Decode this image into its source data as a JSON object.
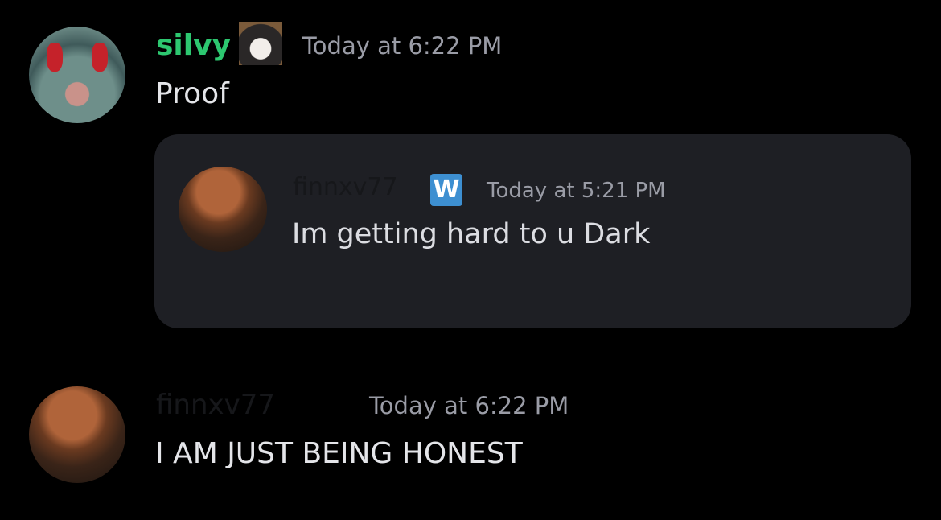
{
  "messages": [
    {
      "author": "silvy",
      "author_color": "#2dc770",
      "timestamp": "Today at 6:22 PM",
      "text": "Proof",
      "embed": {
        "author": "finnxv77",
        "badge": "W",
        "badge_color": "#3d8fd1",
        "timestamp": "Today at 5:21 PM",
        "text": "Im getting hard to u Dark"
      }
    },
    {
      "author": "finnxv77",
      "timestamp": "Today at 6:22 PM",
      "text": "I AM JUST BEING HONEST"
    }
  ],
  "colors": {
    "background": "#000000",
    "embed_background": "#1e1f24",
    "dark_name": "#16171a"
  }
}
